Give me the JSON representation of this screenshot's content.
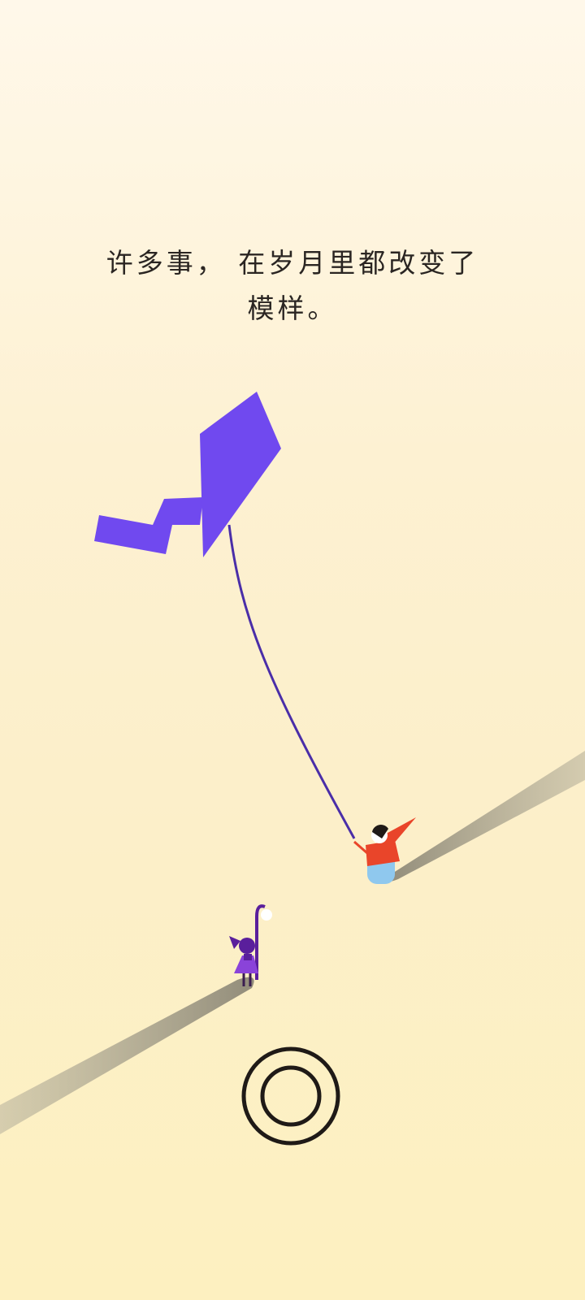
{
  "caption": {
    "line1": "许多事， 在岁月里都改变了",
    "line2": "模样。"
  },
  "colors": {
    "kite": "#7049ef",
    "kite_string": "#4a2ea8",
    "girl": "#5a1f9c",
    "girl_dress": "#8a43d9",
    "old_woman_scarf": "#e9452a",
    "old_woman_body": "#8fc8ee",
    "shadow": "#8c8776",
    "button": "#1f1a17"
  },
  "icons": {
    "action_button": "double-circle-icon"
  }
}
